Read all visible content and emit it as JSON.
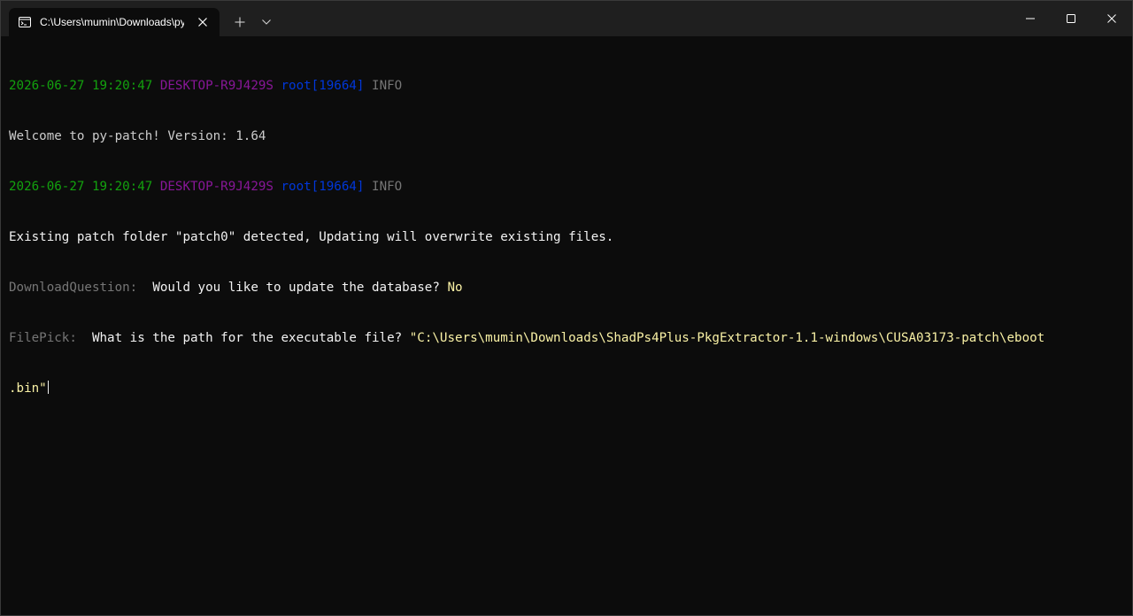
{
  "window": {
    "tab_title": "C:\\Users\\mumin\\Downloads\\py",
    "icons": {
      "tab": "terminal-icon",
      "tab_close": "close-icon",
      "new_tab": "plus-icon",
      "dropdown": "chevron-down-icon",
      "minimize": "minimize-icon",
      "maximize": "maximize-icon",
      "close": "close-icon"
    }
  },
  "terminal": {
    "log1": {
      "timestamp": "2026-06-27 19:20:47",
      "host": "DESKTOP-R9J429S",
      "user": "root[19664]",
      "level": "INFO"
    },
    "message1": "Welcome to py-patch! Version: 1.64",
    "log2": {
      "timestamp": "2026-06-27 19:20:47",
      "host": "DESKTOP-R9J429S",
      "user": "root[19664]",
      "level": "INFO"
    },
    "message2": "Existing patch folder \"patch0\" detected, Updating will overwrite existing files.",
    "question1": {
      "prompt_label": "DownloadQuestion:",
      "question": "Would you like to update the database?",
      "answer": "No"
    },
    "question2": {
      "prompt_label": "FilePick:",
      "question": "What is the path for the executable file?",
      "answer_line1": "\"C:\\Users\\mumin\\Downloads\\ShadPs4Plus-PkgExtractor-1.1-windows\\CUSA03173-patch\\eboot",
      "answer_line2": ".bin\""
    }
  },
  "colors": {
    "background": "#0c0c0c",
    "titlebar": "#1f1f1f",
    "timestamp": "#13a10e",
    "host": "#881798",
    "user": "#0037da",
    "level": "#767676",
    "answer": "#f9f1a5"
  }
}
